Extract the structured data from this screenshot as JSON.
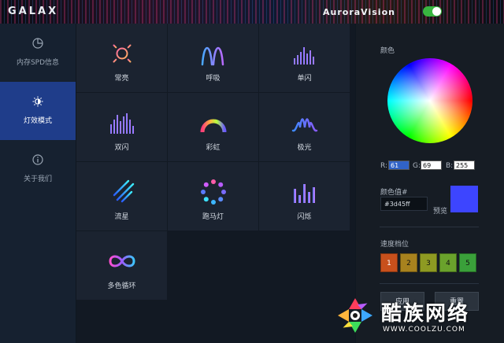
{
  "titlebar": {
    "brand": "GALAX",
    "app_title": "AuroraVision"
  },
  "power_toggle": {
    "state": "on",
    "color": "#38b640"
  },
  "sidebar": {
    "items": [
      {
        "label": "内存SPD信息",
        "icon": "pie-chart-icon",
        "active": false
      },
      {
        "label": "灯效模式",
        "icon": "brightness-icon",
        "active": true
      },
      {
        "label": "关于我们",
        "icon": "info-icon",
        "active": false
      }
    ]
  },
  "effects": [
    {
      "label": "常亮",
      "icon": "sun-icon"
    },
    {
      "label": "呼吸",
      "icon": "breathing-wave-icon"
    },
    {
      "label": "单闪",
      "icon": "single-flash-bars-icon"
    },
    {
      "label": "双闪",
      "icon": "double-flash-bars-icon"
    },
    {
      "label": "彩虹",
      "icon": "rainbow-icon"
    },
    {
      "label": "极光",
      "icon": "aurora-icon"
    },
    {
      "label": "流星",
      "icon": "meteor-icon"
    },
    {
      "label": "跑马灯",
      "icon": "marquee-dots-icon"
    },
    {
      "label": "闪烁",
      "icon": "flicker-bars-icon"
    },
    {
      "label": "多色循环",
      "icon": "infinity-loop-icon"
    }
  ],
  "color_panel": {
    "color_label": "颜色",
    "r_label": "R:",
    "r_value": "61",
    "g_label": "G:",
    "g_value": "69",
    "b_label": "B:",
    "b_value": "255",
    "hex_label": "颜色值#",
    "hex_value": "#3d45ff",
    "preview_label": "预览",
    "preview_color": "#3d45ff"
  },
  "speed": {
    "label": "速度档位",
    "levels": [
      "1",
      "2",
      "3",
      "4",
      "5"
    ],
    "colors": [
      "#c8501c",
      "#a8821e",
      "#8e9a22",
      "#6aa22c",
      "#3aa03a"
    ]
  },
  "buttons": {
    "apply": "应用",
    "reset": "重置"
  },
  "watermark": {
    "text": "酷族网络",
    "url": "WWW.COOLZU.COM"
  }
}
